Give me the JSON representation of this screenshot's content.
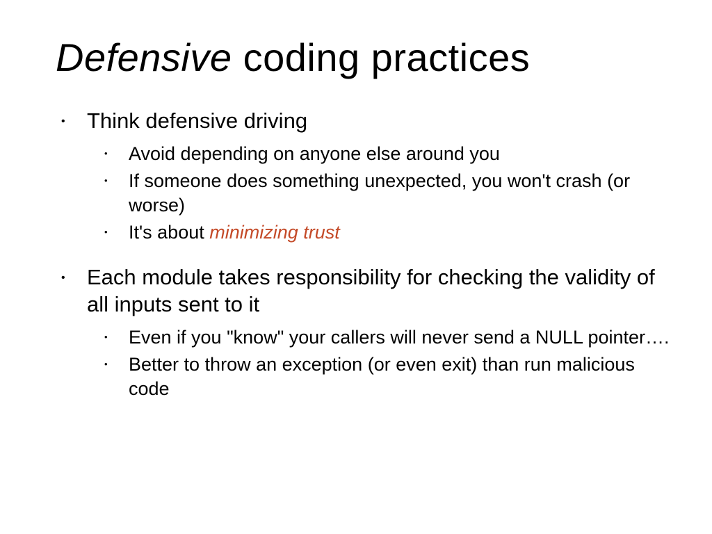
{
  "title_italic": "Defensive",
  "title_rest": " coding practices",
  "bullet1": "Think defensive driving",
  "bullet1_sub1": "Avoid depending on anyone else around you",
  "bullet1_sub2": "If someone does something unexpected, you won't crash (or worse)",
  "bullet1_sub3_a": "It's about ",
  "bullet1_sub3_b": "minimizing trust",
  "bullet2": "Each module takes responsibility for checking the validity of all inputs sent to it",
  "bullet2_sub1": "Even if you \"know\" your callers will never send a NULL pointer….",
  "bullet2_sub2": "Better to throw an exception (or even exit) than run malicious code"
}
